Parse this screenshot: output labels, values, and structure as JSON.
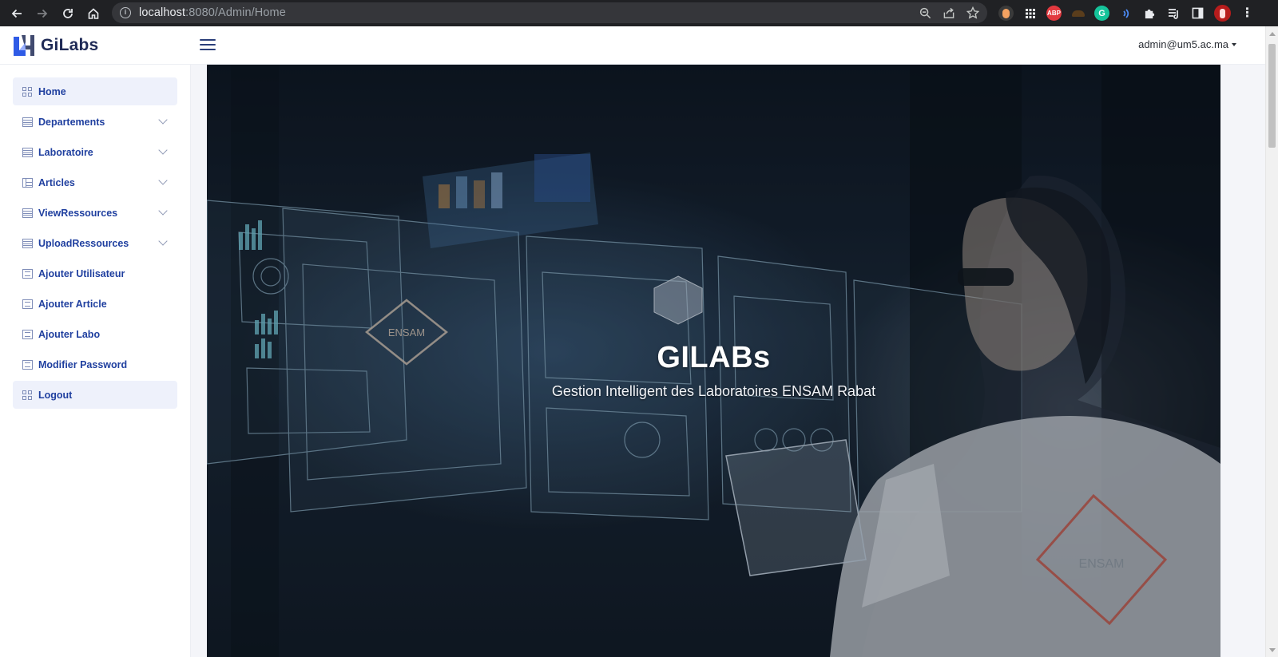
{
  "browser": {
    "url_host": "localhost",
    "url_rest": ":8080/Admin/Home",
    "icons": {
      "back": "arrow-left-icon",
      "forward": "arrow-right-icon",
      "reload": "reload-icon",
      "home": "home-icon",
      "info": "info-icon",
      "zoom": "zoom-icon",
      "share": "share-icon",
      "bookmark": "star-icon"
    },
    "extensions": [
      {
        "name": "extension-orange-icon",
        "text": "",
        "color": "#f4a261"
      },
      {
        "name": "extension-grid-icon",
        "text": "",
        "color": "#3c4043"
      },
      {
        "name": "adblock-plus-icon",
        "text": "ABP",
        "color": "#e2393f"
      },
      {
        "name": "extension-dark-icon",
        "text": "",
        "color": "#5a3d1c"
      },
      {
        "name": "grammarly-icon",
        "text": "G",
        "color": "#15c39a"
      },
      {
        "name": "extension-wave-icon",
        "text": "",
        "color": "#1a73e8"
      },
      {
        "name": "puzzle-icon",
        "text": "",
        "color": "#202124"
      },
      {
        "name": "reading-list-icon",
        "text": "",
        "color": "#202124"
      },
      {
        "name": "side-panel-icon",
        "text": "",
        "color": "#202124"
      },
      {
        "name": "profile-avatar-icon",
        "text": "",
        "color": "#b71c1c"
      },
      {
        "name": "more-menu-icon",
        "text": "",
        "color": "#202124"
      }
    ]
  },
  "header": {
    "brand": "GiLabs",
    "user": "admin@um5.ac.ma",
    "brand_color": "#1f2a56",
    "accent_color": "#2f5be6"
  },
  "sidebar": {
    "items": [
      {
        "label": "Home",
        "icon": "grid-icon",
        "active": true,
        "expandable": false
      },
      {
        "label": "Departements",
        "icon": "table-icon",
        "active": false,
        "expandable": true
      },
      {
        "label": "Laboratoire",
        "icon": "table-icon",
        "active": false,
        "expandable": true
      },
      {
        "label": "Articles",
        "icon": "document-icon",
        "active": false,
        "expandable": true
      },
      {
        "label": "ViewRessources",
        "icon": "table-icon",
        "active": false,
        "expandable": true
      },
      {
        "label": "UploadRessources",
        "icon": "table-icon",
        "active": false,
        "expandable": true
      },
      {
        "label": "Ajouter Utilisateur",
        "icon": "list-icon",
        "active": false,
        "expandable": false
      },
      {
        "label": "Ajouter Article",
        "icon": "list-icon",
        "active": false,
        "expandable": false
      },
      {
        "label": "Ajouter Labo",
        "icon": "list-icon",
        "active": false,
        "expandable": false
      },
      {
        "label": "Modifier Password",
        "icon": "list-icon",
        "active": false,
        "expandable": false
      },
      {
        "label": "Logout",
        "icon": "grid-icon",
        "active": true,
        "expandable": false
      }
    ]
  },
  "hero": {
    "title": "GILABs",
    "subtitle": "Gestion Intelligent des Laboratoires ENSAM Rabat",
    "panel_logo": "ENSAM",
    "coat_logo": "ENSAM"
  }
}
